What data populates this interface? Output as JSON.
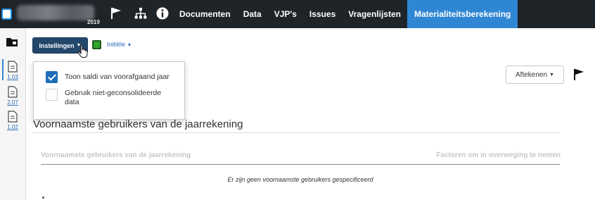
{
  "topbar": {
    "year": "2019",
    "nav": [
      "Documenten",
      "Data",
      "VJP's",
      "Issues",
      "Vragenlijsten",
      "Materialiteitsberekening"
    ],
    "active_index": 5
  },
  "rail": {
    "docs": [
      "1.03",
      "2.07",
      "1.02"
    ]
  },
  "toolbar": {
    "settings_label": "Instellingen",
    "phase_label": "Initiële",
    "status_color": "#2ea52e"
  },
  "settings_menu": {
    "options": [
      {
        "label": "Toon saldi van voorafgaand jaar",
        "checked": true
      },
      {
        "label": "Gebruik niet-geconsolideerde data",
        "checked": false
      }
    ]
  },
  "actions": {
    "sign_label": "Aftekenen"
  },
  "section": {
    "title": "Voornaamste gebruikers van de jaarrekening",
    "columns": [
      "Voornaamste gebruikers van de jaarrekening",
      "Factoren om in overweging te nemen"
    ],
    "empty_message": "Er zijn geen voornaamste gebruikers gespecificeerd"
  },
  "colors": {
    "topbar": "#1f2428",
    "active_tab": "#2f87d3",
    "primary_button": "#23486b",
    "link": "#2f6fb7"
  }
}
